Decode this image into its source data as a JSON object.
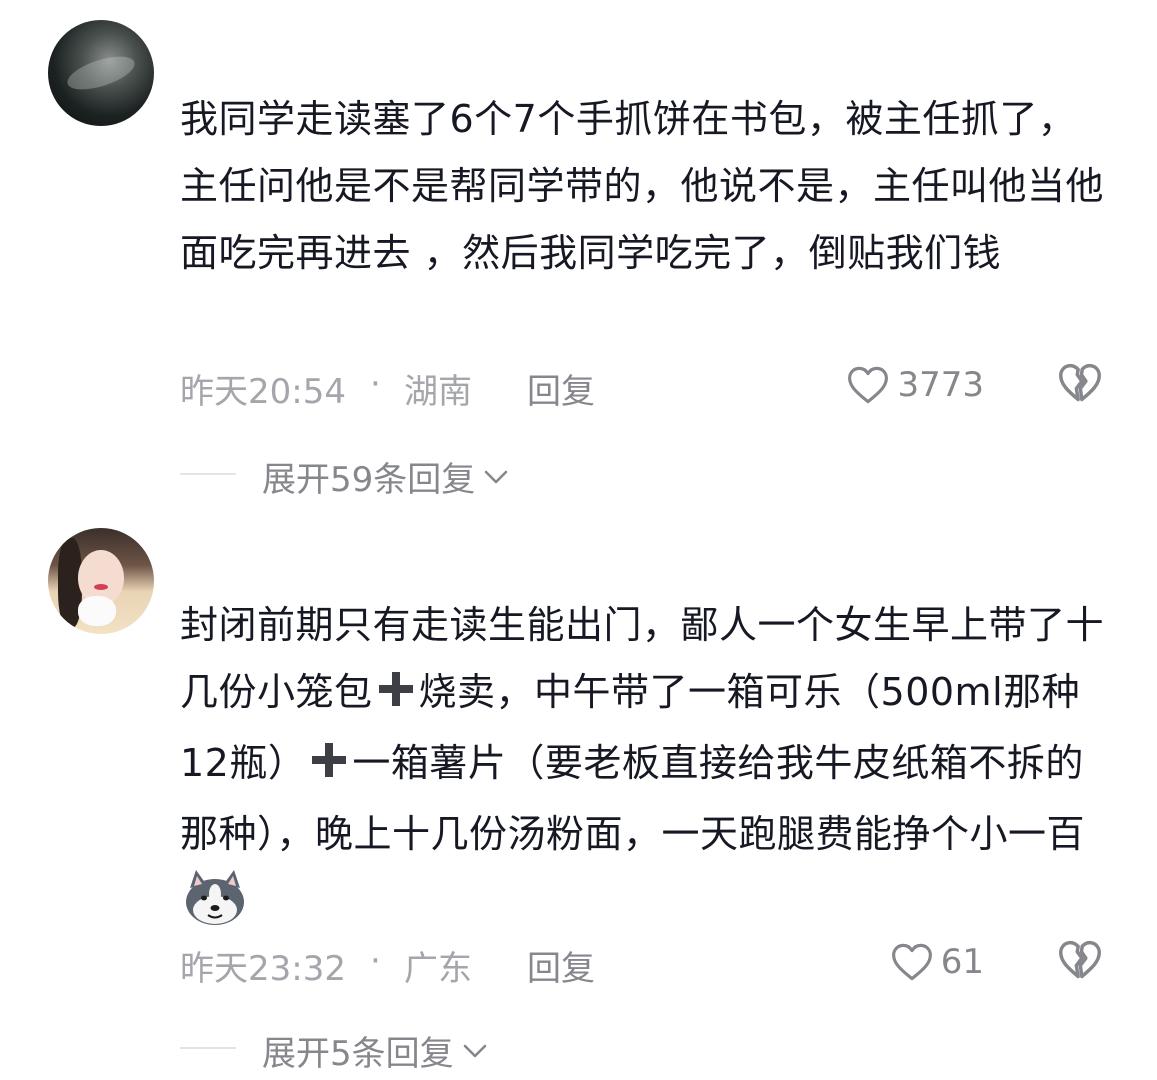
{
  "comments": [
    {
      "text": "我同学走读塞了6个7个手抓饼在书包，被主任抓了，主任问他是不是帮同学带的，他说不是，主任叫他当他面吃完再进去 ，然后我同学吃完了，倒贴我们钱",
      "time": "昨天20:54",
      "separator": "·",
      "location": "湖南",
      "reply_label": "回复",
      "likes": "3773",
      "expand_label": "展开59条回复"
    },
    {
      "text_parts": [
        "封闭前期只有走读生能出门，鄙人一个女生早上带了十几份小笼包",
        "烧卖，中午带了一箱可乐（500ml那种12瓶）",
        "一箱薯片（要老板直接给我牛皮纸箱不拆的那种），晚上十几份汤粉面，一天跑腿费能挣个小一百"
      ],
      "time": "昨天23:32",
      "separator": "·",
      "location": "广东",
      "reply_label": "回复",
      "likes": "61",
      "expand_label": "展开5条回复"
    }
  ],
  "icons": {
    "like": "heart-outline-icon",
    "dislike": "broken-heart-icon",
    "expand": "chevron-down-icon",
    "plus": "heavy-plus-icon",
    "emoji": "husky-dog-emoji"
  },
  "colors": {
    "text": "#161823",
    "meta": "#a4a6ab",
    "action": "#86878c"
  }
}
